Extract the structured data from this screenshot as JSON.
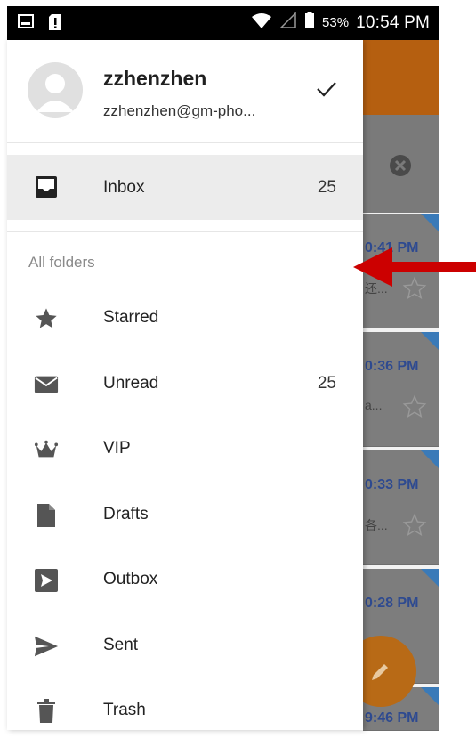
{
  "status_bar": {
    "battery_percent": "53%",
    "time": "10:54 PM"
  },
  "account": {
    "name": "zzhenzhen",
    "email": "zzhenzhen@gm-pho..."
  },
  "inbox": {
    "label": "Inbox",
    "count": "25"
  },
  "section_title": "All folders",
  "folders": [
    {
      "label": "Starred",
      "icon": "star-icon",
      "count": ""
    },
    {
      "label": "Unread",
      "icon": "envelope-icon",
      "count": "25"
    },
    {
      "label": "VIP",
      "icon": "crown-icon",
      "count": ""
    },
    {
      "label": "Drafts",
      "icon": "document-icon",
      "count": ""
    },
    {
      "label": "Outbox",
      "icon": "outbox-icon",
      "count": ""
    },
    {
      "label": "Sent",
      "icon": "send-icon",
      "count": ""
    },
    {
      "label": "Trash",
      "icon": "trash-icon",
      "count": ""
    }
  ],
  "background_mail_times": [
    "0:41 PM",
    "0:36 PM",
    "0:33 PM",
    "0:28 PM",
    "9:46 PM"
  ],
  "background_mail_fragments": [
    "还...",
    "a...",
    "各...",
    ""
  ],
  "colors": {
    "accent_orange": "#b55f10",
    "annotation_arrow": "#cc0000",
    "time_blue": "#2e4a90"
  }
}
